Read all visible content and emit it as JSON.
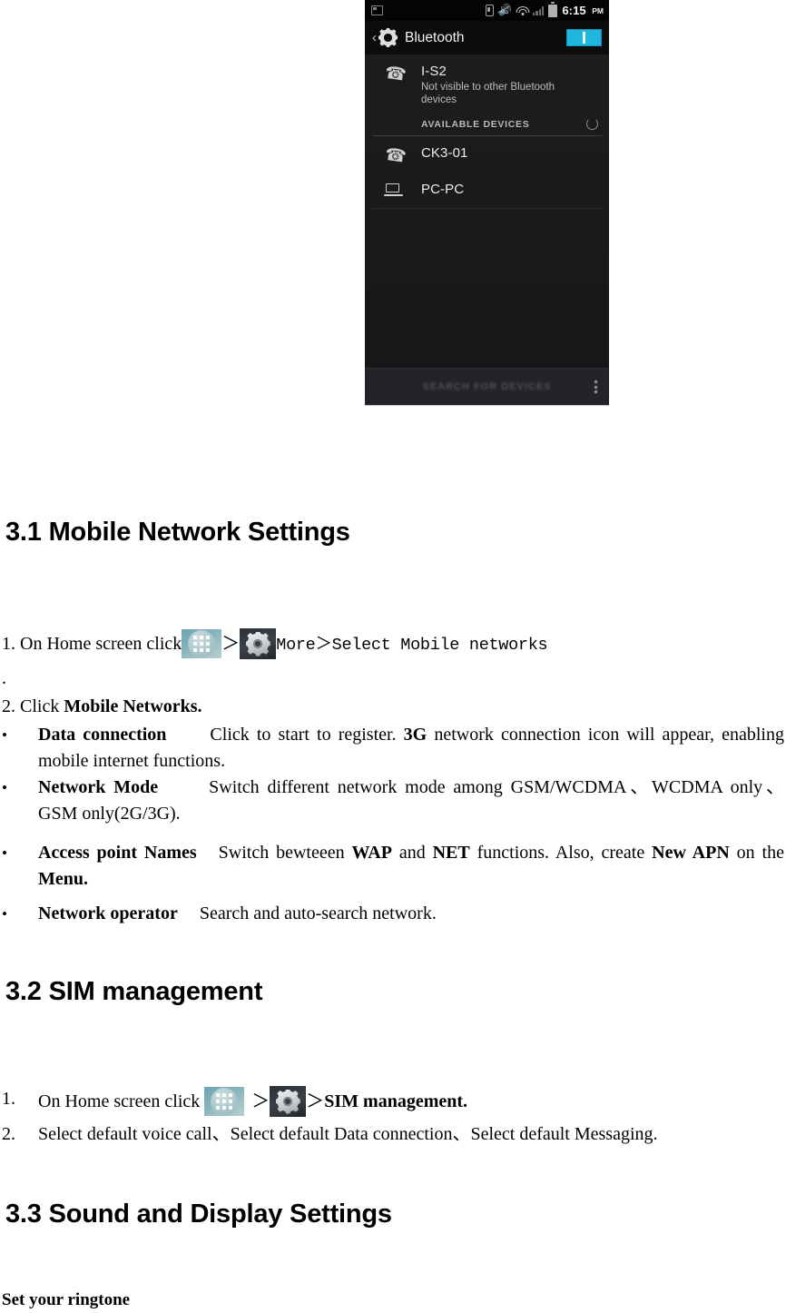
{
  "phone_screenshot": {
    "status_bar": {
      "icons": [
        "screenshot-icon",
        "usb-icon",
        "mute-icon",
        "wifi-icon",
        "signal-icon",
        "battery-icon"
      ],
      "clock": "6:15",
      "ampm": "PM"
    },
    "action_bar": {
      "back_glyph": "‹",
      "settings_icon": "gear-icon",
      "title": "Bluetooth",
      "toggle_state": "on",
      "toggle_color": "#1fb6e0"
    },
    "own_device": {
      "icon": "phone-icon",
      "name": "I-S2",
      "subtitle": "Not visible to other Bluetooth devices"
    },
    "section_header": {
      "label": "AVAILABLE DEVICES",
      "spinner": "scanning-spinner-icon"
    },
    "devices": [
      {
        "icon": "phone-icon",
        "name": "CK3-01"
      },
      {
        "icon": "laptop-icon",
        "name": "PC-PC"
      }
    ],
    "bottom_bar": {
      "search_label": "SEARCH FOR DEVICES",
      "overflow": "overflow-menu-icon"
    }
  },
  "doc": {
    "s31": {
      "heading": "3.1 Mobile Network Settings",
      "step1_prefix": "1. On Home screen click",
      "step1_gt1": "＞",
      "step1_gt2": "＞",
      "step1_mono": "More＞Select Mobile networks",
      "orphan_period": ".",
      "step2_prefix": "2. Click ",
      "step2_bold": "Mobile Networks.",
      "bullets": [
        {
          "marker": "•",
          "term": "Data connection",
          "text_a": "Click to start to register. ",
          "bold_b": "3G",
          "text_c": " network connection icon will appear, enabling mobile internet functions."
        },
        {
          "marker": "•",
          "term": "Network Mode",
          "text_a": "Switch different network mode among GSM/WCDMA、WCDMA only、GSM only(2G/3G)."
        },
        {
          "marker": "•",
          "term": "Access point Names",
          "text_a": "Switch bewteeen ",
          "bold_b": "WAP",
          "text_c": " and ",
          "bold_d": "NET",
          "text_e": " functions. Also, create ",
          "bold_f": "New APN",
          "text_g": " on the ",
          "bold_h": "Menu."
        },
        {
          "marker": "•",
          "term": "Network operator",
          "text_a": "Search and auto-search network."
        }
      ]
    },
    "s32": {
      "heading": "3.2 SIM management",
      "step1_num": "1.",
      "step1_prefix": "On Home screen click",
      "step1_gt1": "＞",
      "step1_gt2": "＞",
      "step1_bold": "SIM management.",
      "step2_num": "2.",
      "step2_text": "Select default voice call、Select default Data connection、Select default Messaging."
    },
    "s33": {
      "heading": "3.3 Sound and Display Settings",
      "subheading": "Set your ringtone"
    }
  }
}
